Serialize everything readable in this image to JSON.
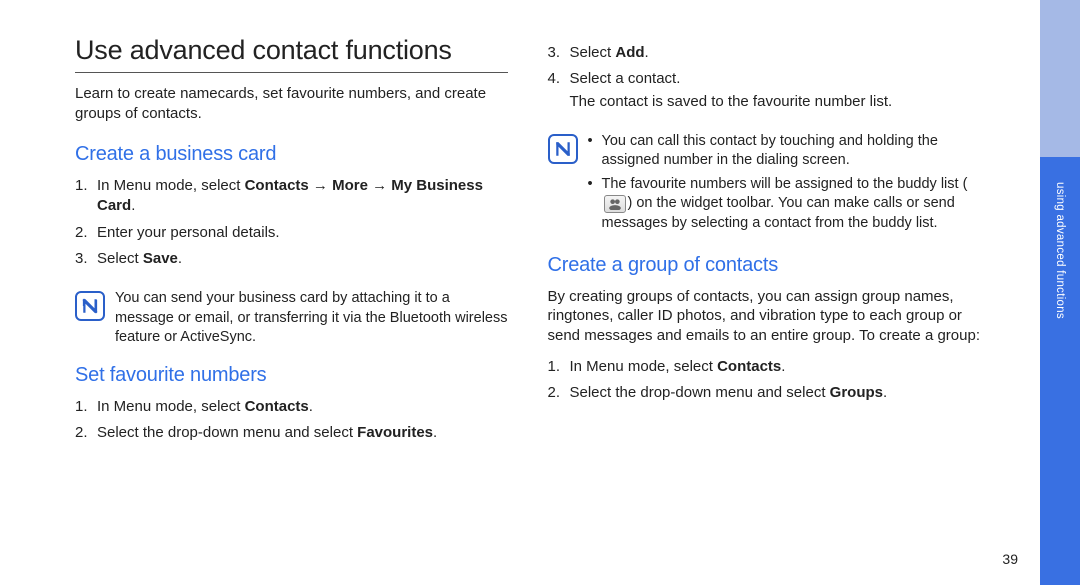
{
  "title": "Use advanced contact functions",
  "intro": "Learn to create namecards, set favourite numbers, and create groups of contacts.",
  "section1": {
    "heading": "Create a business card",
    "steps": [
      {
        "num": "1.",
        "pre": "In Menu mode, select ",
        "bold": "Contacts → More → My Business Card",
        "post": "."
      },
      {
        "num": "2.",
        "pre": "Enter your personal details.",
        "bold": "",
        "post": ""
      },
      {
        "num": "3.",
        "pre": "Select ",
        "bold": "Save",
        "post": "."
      }
    ],
    "note": "You can send your business card by attaching it to a message or email, or transferring it via the Bluetooth wireless feature or ActiveSync."
  },
  "section2": {
    "heading": "Set favourite numbers",
    "steps": [
      {
        "num": "1.",
        "pre": "In Menu mode, select ",
        "bold": "Contacts",
        "post": "."
      },
      {
        "num": "2.",
        "pre": "Select the drop-down menu and select ",
        "bold": "Favourites",
        "post": "."
      }
    ]
  },
  "section2b": {
    "steps": [
      {
        "num": "3.",
        "pre": "Select ",
        "bold": "Add",
        "post": "."
      },
      {
        "num": "4.",
        "pre": "Select a contact.",
        "bold": "",
        "post": "",
        "sub": "The contact is saved to the favourite number list."
      }
    ],
    "notes": [
      "You can call this contact by touching and holding the assigned number in the dialing screen.",
      {
        "pre": "The favourite numbers will be assigned to the buddy list (",
        "post": ") on the widget toolbar. You can make calls or send messages by selecting a contact from the buddy list."
      }
    ]
  },
  "section3": {
    "heading": "Create a group of contacts",
    "body": "By creating groups of contacts, you can assign group names, ringtones, caller ID photos, and vibration type to each group or send messages and emails to an entire group. To create a group:",
    "steps": [
      {
        "num": "1.",
        "pre": "In Menu mode, select ",
        "bold": "Contacts",
        "post": "."
      },
      {
        "num": "2.",
        "pre": "Select the drop-down menu and select ",
        "bold": "Groups",
        "post": "."
      }
    ]
  },
  "sideTab": "using advanced functions",
  "pageNumber": "39"
}
